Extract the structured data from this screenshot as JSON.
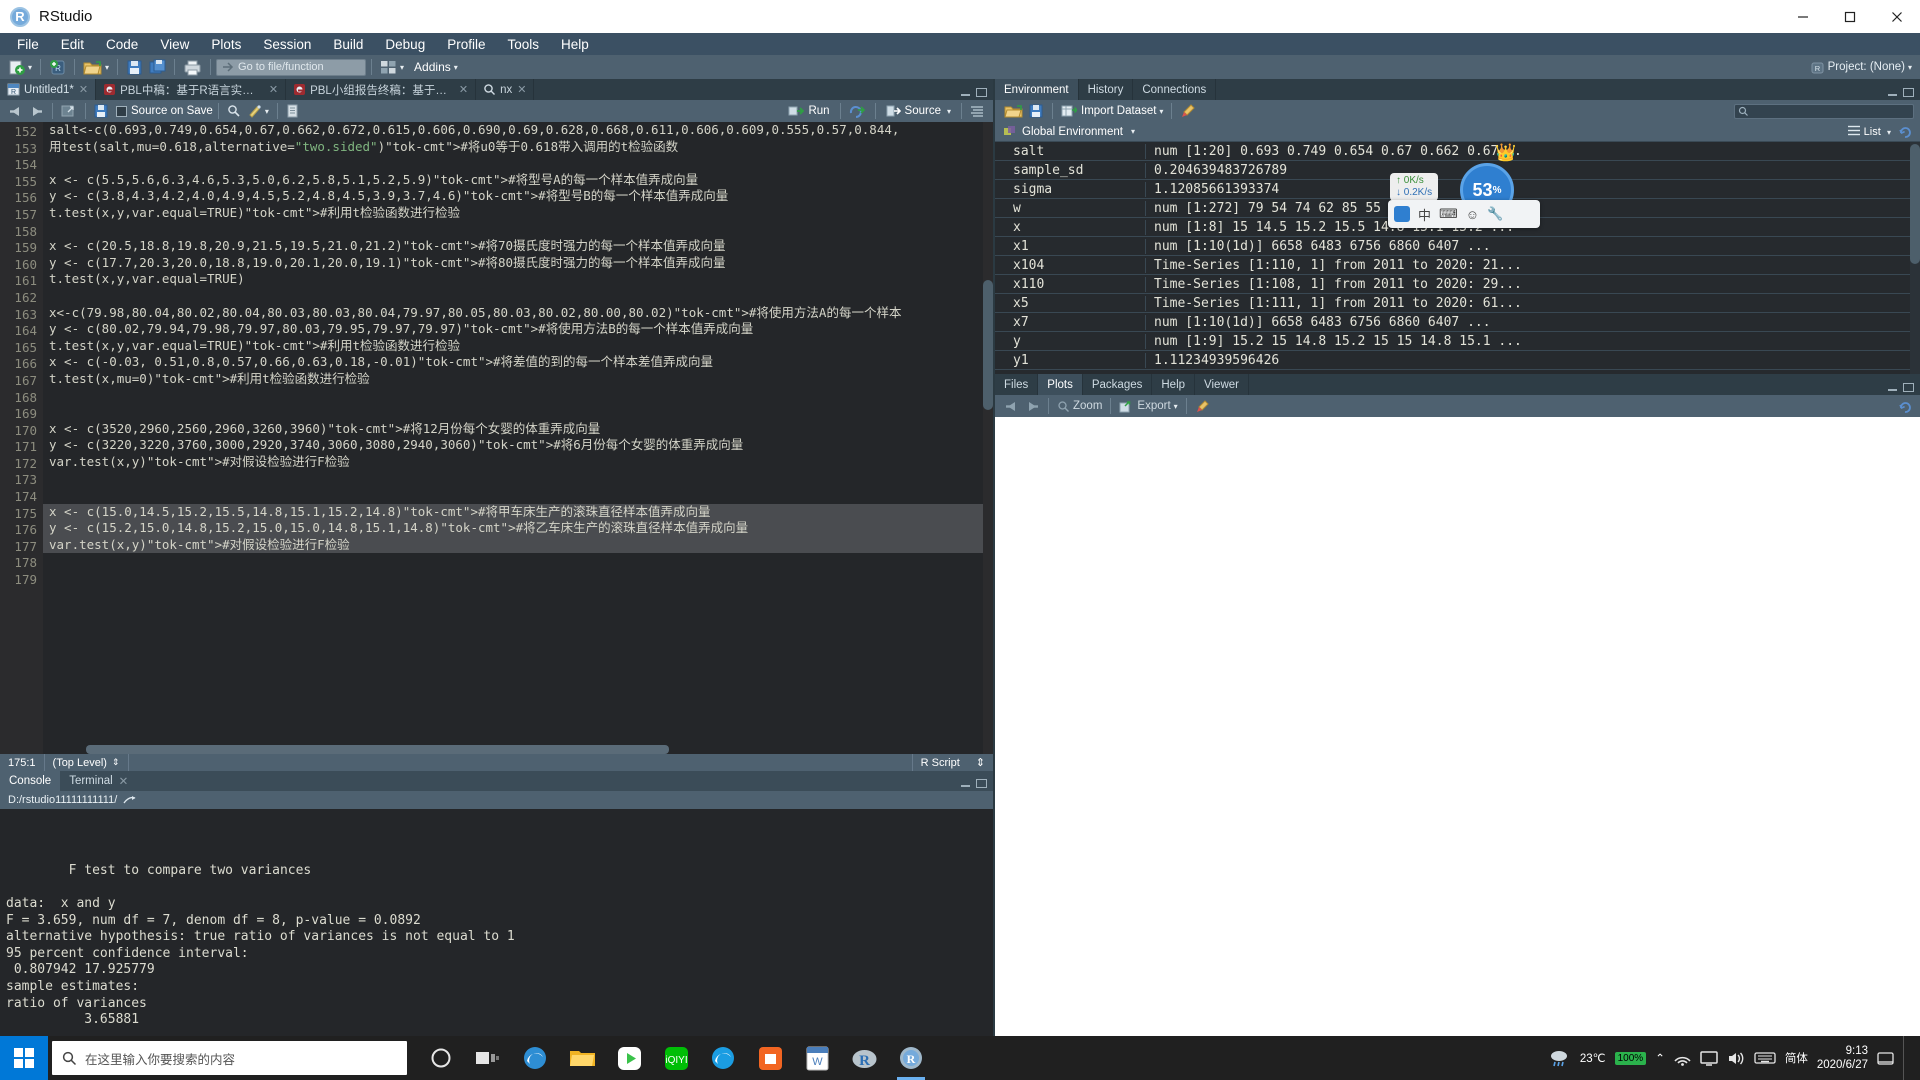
{
  "window": {
    "title": "RStudio",
    "app_icon": "r-logo-icon",
    "minimize": "–",
    "maximize": "▢",
    "close": "✕"
  },
  "menubar": [
    "File",
    "Edit",
    "Code",
    "View",
    "Plots",
    "Session",
    "Build",
    "Debug",
    "Profile",
    "Tools",
    "Help"
  ],
  "toolbar": {
    "goto_placeholder": "Go to file/function",
    "addins": "Addins",
    "project": "Project: (None)"
  },
  "source_tabs": [
    {
      "label": "Untitled1*",
      "icon": "r-doc-icon",
      "active": true
    },
    {
      "label": "PBL中稿：基于R语言实现重庆房价走势…",
      "icon": "rmd-doc-icon",
      "active": false
    },
    {
      "label": "PBL小组报告终稿：基于R语言实现重庆…",
      "icon": "rmd-doc-icon",
      "active": false
    },
    {
      "label": "nx",
      "icon": "search-icon",
      "active": false
    }
  ],
  "source_toolbar": {
    "back": "◀",
    "forward": "▶",
    "source_on_save": "Source on Save",
    "run": "Run",
    "rerun": "rerun-icon",
    "source": "Source",
    "outline": "outline-icon"
  },
  "editor": {
    "first_line_number": 152,
    "lines": [
      {
        "n": 152,
        "text": "salt<-c(0.693,0.749,0.654,0.67,0.662,0.672,0.615,0.606,0.690,0.69,0.628,0.668,0.611,0.606,0.609,0.555,0.57,0.844,"
      },
      {
        "n": 153,
        "text": "用test(salt,mu=0.618,alternative=\"two.sided\")#将u0等于0.618带入调用的t检验函数"
      },
      {
        "n": 154,
        "text": ""
      },
      {
        "n": 155,
        "text": "x <- c(5.5,5.6,6.3,4.6,5.3,5.0,6.2,5.8,5.1,5.2,5.9)#将型号A的每一个样本值弄成向量"
      },
      {
        "n": 156,
        "text": "y <- c(3.8,4.3,4.2,4.0,4.9,4.5,5.2,4.8,4.5,3.9,3.7,4.6)#将型号B的每一个样本值弄成向量"
      },
      {
        "n": 157,
        "text": "t.test(x,y,var.equal=TRUE)#利用t检验函数进行检验"
      },
      {
        "n": 158,
        "text": ""
      },
      {
        "n": 159,
        "text": "x <- c(20.5,18.8,19.8,20.9,21.5,19.5,21.0,21.2)#将70摄氏度时强力的每一个样本值弄成向量"
      },
      {
        "n": 160,
        "text": "y <- c(17.7,20.3,20.0,18.8,19.0,20.1,20.0,19.1)#将80摄氏度时强力的每一个样本值弄成向量"
      },
      {
        "n": 161,
        "text": "t.test(x,y,var.equal=TRUE)"
      },
      {
        "n": 162,
        "text": ""
      },
      {
        "n": 163,
        "text": "x<-c(79.98,80.04,80.02,80.04,80.03,80.03,80.04,79.97,80.05,80.03,80.02,80.00,80.02)#将使用方法A的每一个样本"
      },
      {
        "n": 164,
        "text": "y <- c(80.02,79.94,79.98,79.97,80.03,79.95,79.97,79.97)#将使用方法B的每一个样本值弄成向量"
      },
      {
        "n": 165,
        "text": "t.test(x,y,var.equal=TRUE)#利用t检验函数进行检验"
      },
      {
        "n": 166,
        "text": "x <- c(-0.03, 0.51,0.8,0.57,0.66,0.63,0.18,-0.01)#将差值的到的每一个样本差值弄成向量"
      },
      {
        "n": 167,
        "text": "t.test(x,mu=0)#利用t检验函数进行检验"
      },
      {
        "n": 168,
        "text": ""
      },
      {
        "n": 169,
        "text": ""
      },
      {
        "n": 170,
        "text": "x <- c(3520,2960,2560,2960,3260,3960)#将12月份每个女婴的体重弄成向量"
      },
      {
        "n": 171,
        "text": "y <- c(3220,3220,3760,3000,2920,3740,3060,3080,2940,3060)#将6月份每个女婴的体重弄成向量"
      },
      {
        "n": 172,
        "text": "var.test(x,y)#对假设检验进行F检验"
      },
      {
        "n": 173,
        "text": ""
      },
      {
        "n": 174,
        "text": ""
      },
      {
        "n": 175,
        "text": "x <- c(15.0,14.5,15.2,15.5,14.8,15.1,15.2,14.8)#将甲车床生产的滚珠直径样本值弄成向量",
        "selected": true
      },
      {
        "n": 176,
        "text": "y <- c(15.2,15.0,14.8,15.2,15.0,15.0,14.8,15.1,14.8)#将乙车床生产的滚珠直径样本值弄成向量",
        "selected": true
      },
      {
        "n": 177,
        "text": "var.test(x,y)#对假设检验进行F检验",
        "selected": true
      },
      {
        "n": 178,
        "text": ""
      },
      {
        "n": 179,
        "text": ""
      }
    ]
  },
  "editor_status": {
    "cursor": "175:1",
    "scope": "(Top Level)",
    "filetype": "R Script"
  },
  "console": {
    "tabs": [
      {
        "label": "Console",
        "active": true
      },
      {
        "label": "Terminal",
        "active": false,
        "closable": true
      }
    ],
    "path": "D:/rstudio11111111111/",
    "output": [
      "",
      "\tF test to compare two variances",
      "",
      "data:  x and y",
      "F = 3.659, num df = 7, denom df = 8, p-value = 0.0892",
      "alternative hypothesis: true ratio of variances is not equal to 1",
      "95 percent confidence interval:",
      " 0.807942 17.925779",
      "sample estimates:",
      "ratio of variances ",
      "          3.65881 ",
      ""
    ],
    "prompt": "> "
  },
  "environment": {
    "tabs": [
      {
        "label": "Environment",
        "active": true
      },
      {
        "label": "History",
        "active": false
      },
      {
        "label": "Connections",
        "active": false
      }
    ],
    "toolbar": {
      "load": "open-folder-icon",
      "save": "save-icon",
      "import": "Import Dataset",
      "broom": "broom-icon",
      "list_view": "List",
      "refresh": "refresh-icon"
    },
    "scope": "Global Environment",
    "variables": [
      {
        "name": "salt",
        "value": "num [1:20] 0.693 0.749 0.654 0.67 0.662 0.67..."
      },
      {
        "name": "sample_sd",
        "value": "0.204639483726789"
      },
      {
        "name": "sigma",
        "value": "1.12085661393374"
      },
      {
        "name": "w",
        "value": "num [1:272] 79 54 74 62 85 55 88 85 85 54 ..."
      },
      {
        "name": "x",
        "value": "num [1:8] 15 14.5 15.2 15.5 14.8 15.1 15.2 ..."
      },
      {
        "name": "x1",
        "value": "num [1:10(1d)] 6658 6483 6756 6860 6407 ..."
      },
      {
        "name": "x104",
        "value": "Time-Series [1:110, 1] from 2011 to 2020: 21..."
      },
      {
        "name": "x110",
        "value": "Time-Series [1:108, 1] from 2011 to 2020: 29..."
      },
      {
        "name": "x5",
        "value": "Time-Series [1:111, 1] from 2011 to 2020: 61..."
      },
      {
        "name": "x7",
        "value": "num [1:10(1d)] 6658 6483 6756 6860 6407 ..."
      },
      {
        "name": "y",
        "value": "num [1:9] 15.2 15 14.8 15.2 15 15 14.8 15.1 ..."
      },
      {
        "name": "y1",
        "value": "1.11234939596426"
      }
    ]
  },
  "plots": {
    "tabs": [
      {
        "label": "Files",
        "active": false
      },
      {
        "label": "Plots",
        "active": true
      },
      {
        "label": "Packages",
        "active": false
      },
      {
        "label": "Help",
        "active": false
      },
      {
        "label": "Viewer",
        "active": false
      }
    ],
    "toolbar": {
      "back": "◀",
      "forward": "▶",
      "zoom": "Zoom",
      "export": "Export",
      "clear": "broom-icon",
      "refresh": "refresh-icon"
    }
  },
  "net_widget": {
    "upload": "0K/s",
    "download": "0.2K/s",
    "cpu": "53",
    "cpu_unit": "%",
    "crown": "crown-icon"
  },
  "ime_bar": {
    "mode": "中",
    "logo": "sogou-icon"
  },
  "taskbar": {
    "start": "windows-start-icon",
    "search_placeholder": "在这里输入你要搜索的内容",
    "cortana": "cortana-icon",
    "taskview": "task-view-icon",
    "pinned": [
      {
        "name": "edge-icon",
        "color": "#2e8ed4"
      },
      {
        "name": "file-explorer-icon",
        "color": "#ffd04b"
      },
      {
        "name": "media-player-icon",
        "color": "#3ac24a"
      },
      {
        "name": "iqiyi-icon",
        "color": "#00be06"
      },
      {
        "name": "edge-chromium-icon",
        "color": "#1b9de2"
      },
      {
        "name": "store-icon",
        "color": "#f26522"
      },
      {
        "name": "wps-icon",
        "color": "#4a7ebb"
      },
      {
        "name": "rgui-icon",
        "color": "#6ea8d8"
      },
      {
        "name": "rstudio-icon",
        "color": "#75aadb",
        "active": true
      }
    ],
    "tray": {
      "weather_icon": "cloud-rain-icon",
      "temperature": "23℃",
      "battery": "100%",
      "chevron": "⌃",
      "network": "network-icon",
      "monitor": "monitor-icon",
      "volume": "volume-icon",
      "keyboard": "keyboard-icon",
      "ime": "简体",
      "time": "9:13",
      "date": "2020/6/27",
      "notifications": "notification-icon"
    }
  }
}
